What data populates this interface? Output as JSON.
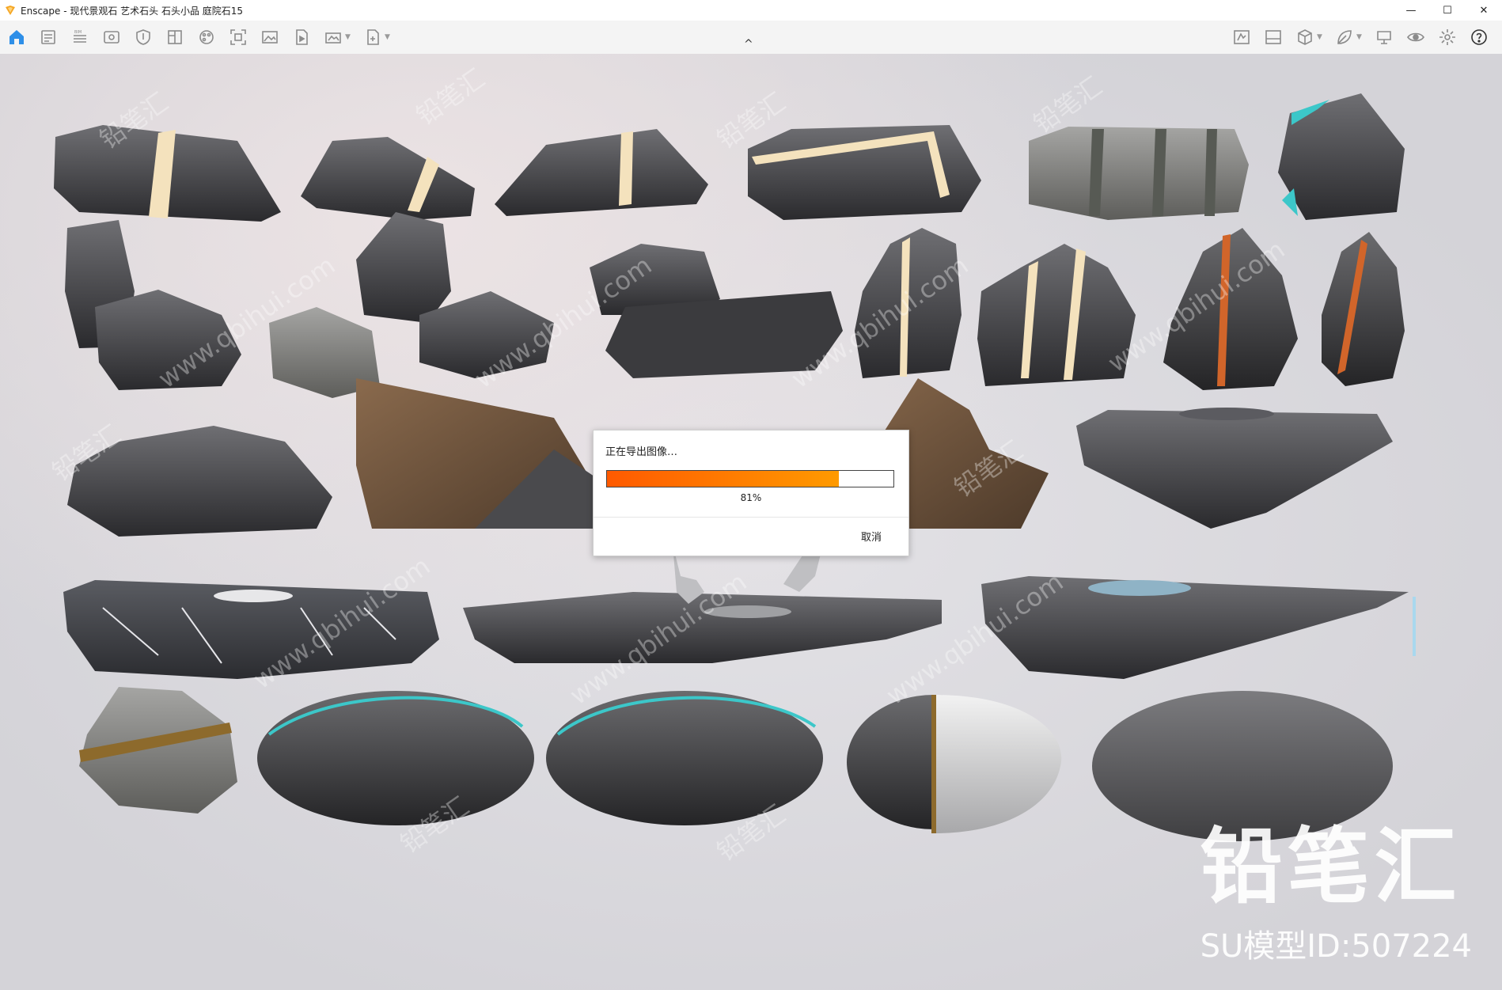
{
  "window": {
    "title": "Enscape - 现代景观石 艺术石头 石头小品 庭院石15",
    "controls": {
      "minimize": "—",
      "maximize": "☐",
      "close": "✕"
    }
  },
  "toolbar": {
    "left_icons": [
      "home-icon",
      "document-icon",
      "bim-icon",
      "view-icon",
      "shield-icon",
      "book-icon",
      "palette-icon",
      "capture-icon",
      "image-icon",
      "video-icon",
      "panorama-icon",
      "export-icon"
    ],
    "right_icons": [
      "asset-library-icon",
      "render-icon",
      "cube-icon",
      "leaf-icon",
      "presentation-icon",
      "eye-icon",
      "settings-icon",
      "help-icon"
    ],
    "collapse_glyph": "^"
  },
  "dialog": {
    "title": "正在导出图像…",
    "progress": 0.81,
    "progress_label": "81%",
    "cancel_label": "取消"
  },
  "watermark": {
    "brand_title": "铅笔汇",
    "brand_sub": "SU模型ID:507224",
    "tiles": [
      "铅笔汇",
      "www.qbihui.com"
    ]
  },
  "colors": {
    "accent": "#2e8fe8",
    "progress_start": "#ff5a00",
    "progress_end": "#ff9a00",
    "stripe": "#f4e2bd",
    "copper": "#d1652a",
    "teal": "#3cc7c9"
  }
}
